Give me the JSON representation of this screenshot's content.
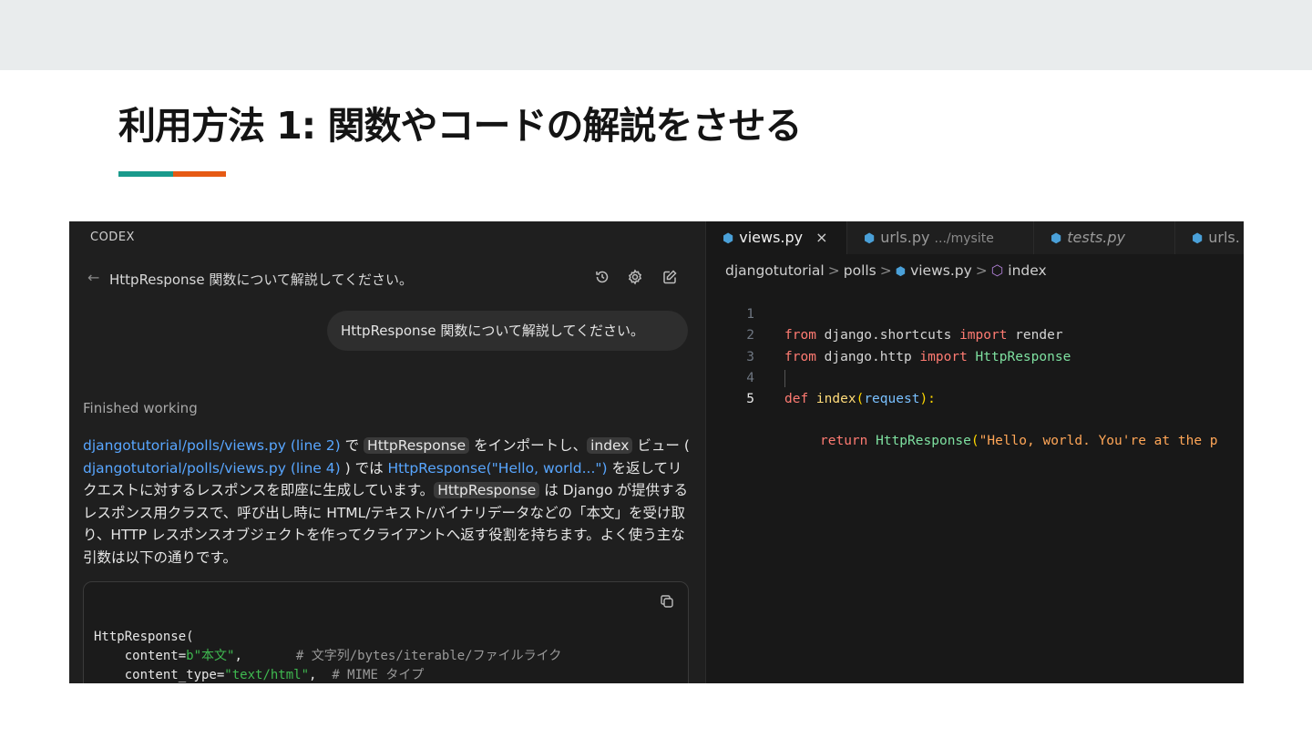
{
  "slide": {
    "title": "利用方法 1: 関数やコードの解説をさせる",
    "accent_colors": [
      "#1a9a8c",
      "#e65a14"
    ]
  },
  "codex_panel": {
    "label": "CODEX",
    "thread_title": "HttpResponse 関数について解説してください。",
    "header_icons": [
      "history-icon",
      "gear-icon",
      "new-chat-icon"
    ],
    "user_message": "HttpResponse 関数について解説してください。",
    "status": "Finished working",
    "answer": {
      "link1": "djangotutorial/polls/views.py (line 2)",
      "t1": " で ",
      "code1": "HttpResponse",
      "t2": " をインポートし、",
      "code2": "index",
      "t3": " ビュー ( ",
      "link2": "djangotutorial/polls/views.py (line 4)",
      "t4": " ) では ",
      "link3": "HttpResponse(\"Hello, world...\")",
      "t5": " を返してリクエストに対するレスポンスを即座に生成しています。",
      "code3": "HttpResponse",
      "t6": " は Django が提供するレスポンス用クラスで、呼び出し時に HTML/テキスト/バイナリデータなどの「本文」を受け取り、HTTP レスポンスオブジェクトを作ってクライアントへ返す役割を持ちます。よく使う主な引数は以下の通りです。"
    },
    "code_block": {
      "line1": "HttpResponse(",
      "line2_key": "    content=",
      "line2_val": "b\"本文\"",
      "line2_pad": ",       ",
      "line2_comment": "# 文字列/bytes/iterable/ファイルライク",
      "line3_key": "    content_type=",
      "line3_val": "\"text/html\"",
      "line3_pad": ",  ",
      "line3_comment": "# MIME タイプ"
    }
  },
  "editor": {
    "tabs": [
      {
        "label": "views.py",
        "close": "×"
      },
      {
        "label": "urls.py",
        "sub": ".../mysite"
      },
      {
        "label": "tests.py"
      },
      {
        "label": "urls."
      }
    ],
    "breadcrumb": {
      "p1": "djangotutorial",
      "p2": "polls",
      "p3": "views.py",
      "p4": "index",
      "sep": ">"
    },
    "lines": [
      {
        "n": "1",
        "kw1": "from",
        "mod": " django.shortcuts ",
        "kw2": "import",
        "name": " render"
      },
      {
        "n": "2",
        "kw1": "from",
        "mod": " django.http ",
        "kw2": "import",
        "name": " HttpResponse"
      },
      {
        "n": "3"
      },
      {
        "n": "4",
        "kw": "def",
        "fn": " index",
        "open": "(",
        "param": "request",
        "close": "):"
      },
      {
        "n": "5",
        "kw": "return",
        "cls": " HttpResponse",
        "open": "(",
        "str": "\"Hello, world. You're at the p"
      }
    ]
  }
}
